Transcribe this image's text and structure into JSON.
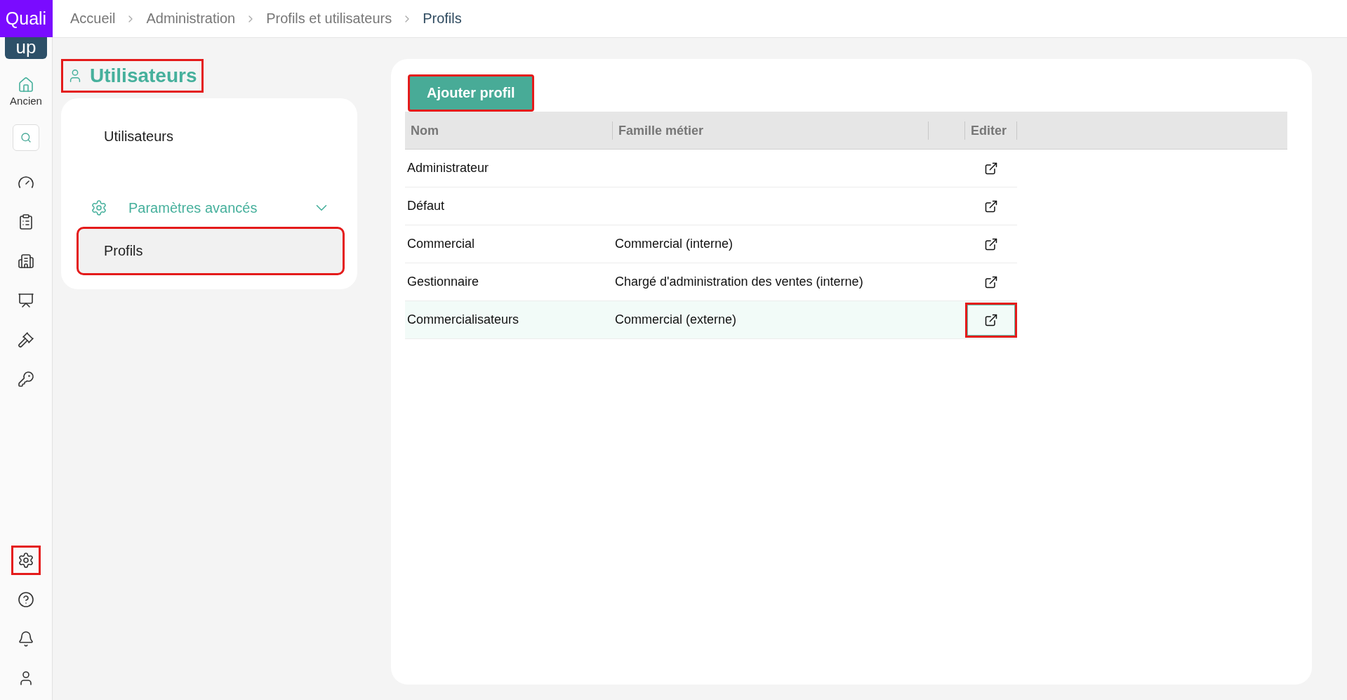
{
  "logo": {
    "top": "Quali",
    "bottom": "up"
  },
  "breadcrumb": [
    {
      "label": "Accueil",
      "current": false
    },
    {
      "label": "Administration",
      "current": false
    },
    {
      "label": "Profils et utilisateurs",
      "current": false
    },
    {
      "label": "Profils",
      "current": true
    }
  ],
  "nav": {
    "top": [
      {
        "kind": "home",
        "label": "Ancien",
        "highlighted": false
      },
      {
        "kind": "search",
        "highlighted": false
      },
      {
        "kind": "gauge",
        "highlighted": false
      },
      {
        "kind": "list",
        "highlighted": false
      },
      {
        "kind": "buildings",
        "highlighted": false
      },
      {
        "kind": "sign",
        "highlighted": false
      },
      {
        "kind": "gavel",
        "highlighted": false
      },
      {
        "kind": "keys",
        "highlighted": false
      }
    ],
    "bottom": [
      {
        "kind": "settings",
        "highlighted": true
      },
      {
        "kind": "help",
        "highlighted": false
      },
      {
        "kind": "bell",
        "highlighted": false
      },
      {
        "kind": "user",
        "highlighted": false
      }
    ]
  },
  "section": {
    "title": "Utilisateurs",
    "highlighted": true
  },
  "menu": [
    {
      "kind": "link",
      "label": "Utilisateurs",
      "selected": false,
      "highlighted": false
    },
    {
      "kind": "group",
      "label": "Paramètres avancés",
      "expanded": true,
      "children": [
        {
          "label": "Profils",
          "selected": true,
          "highlighted": true
        }
      ]
    }
  ],
  "add_button": {
    "label": "Ajouter profil",
    "highlighted": true
  },
  "table": {
    "columns": [
      {
        "label": "Nom"
      },
      {
        "label": "Famille métier"
      },
      {
        "label": "Editer"
      }
    ],
    "rows": [
      {
        "name": "Administrateur",
        "selected": false,
        "edit_highlighted": false
      },
      {
        "name": "Défaut",
        "selected": false,
        "edit_highlighted": false
      },
      {
        "name": "Commercial",
        "family": "Commercial (interne)",
        "selected": false,
        "edit_highlighted": false
      },
      {
        "name": "Gestionnaire",
        "family": "Chargé d'administration des ventes (interne)",
        "selected": false,
        "edit_highlighted": false
      },
      {
        "name": "Commercialisateurs",
        "family": "Commercial (externe)",
        "selected": true,
        "edit_highlighted": true
      }
    ]
  }
}
